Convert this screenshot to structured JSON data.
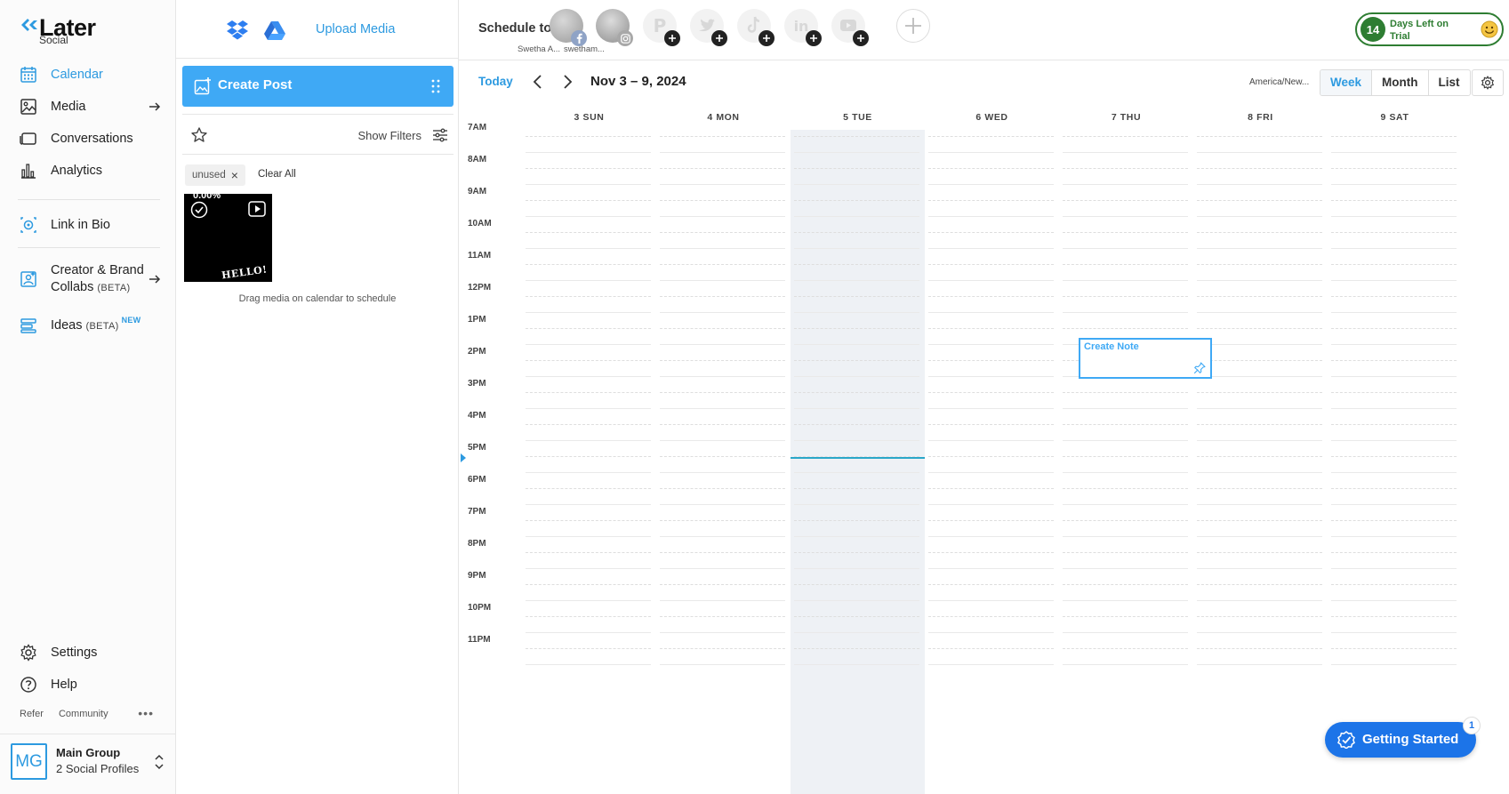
{
  "brand": {
    "name": "Later",
    "product": "Social"
  },
  "colors": {
    "accent": "#2d9ae0",
    "create_post": "#3fa9f5",
    "trial": "#2e7d32",
    "getting_started": "#1c74e8",
    "today_column": "#eef1f5",
    "now_line": "#2aa7c9"
  },
  "sidebar": {
    "items": [
      {
        "label": "Calendar",
        "icon": "calendar-icon",
        "active": true
      },
      {
        "label": "Media",
        "icon": "media-icon",
        "arrow": true
      },
      {
        "label": "Conversations",
        "icon": "conversations-icon"
      },
      {
        "label": "Analytics",
        "icon": "analytics-icon"
      },
      {
        "label": "Link in Bio",
        "icon": "link-in-bio-icon"
      },
      {
        "label_line1": "Creator & Brand",
        "label_line2": "Collabs",
        "beta": "(BETA)",
        "icon": "collabs-icon",
        "arrow": true
      },
      {
        "label": "Ideas",
        "beta": "(BETA)",
        "badge": "NEW",
        "icon": "ideas-icon"
      },
      {
        "label": "Settings",
        "icon": "gear-icon"
      },
      {
        "label": "Help",
        "icon": "help-icon"
      }
    ],
    "footer_links": [
      "Refer",
      "Community"
    ],
    "more_label": "•••",
    "group": {
      "initials": "MG",
      "name": "Main Group",
      "profiles": "2 Social Profiles"
    }
  },
  "media_panel": {
    "upload_label": "Upload Media",
    "create_post_label": "Create Post",
    "show_filters_label": "Show Filters",
    "active_filter": "unused",
    "clear_all_label": "Clear All",
    "thumb_top_text": "0.00%",
    "thumb_caption": "HELLO!",
    "drag_hint": "Drag media on calendar to schedule"
  },
  "header": {
    "schedule_to": "Schedule to",
    "profiles": [
      {
        "name": "Swetha A...",
        "network": "facebook"
      },
      {
        "name": "swetham...",
        "network": "instagram"
      }
    ],
    "add_networks": [
      "pinterest",
      "twitter",
      "tiktok",
      "linkedin",
      "youtube"
    ],
    "trial": {
      "days": "14",
      "text": "Days Left on Trial"
    }
  },
  "calendar": {
    "today_label": "Today",
    "date_range": "Nov 3 – 9, 2024",
    "timezone": "America/New...",
    "views": [
      "Week",
      "Month",
      "List"
    ],
    "active_view": "Week",
    "days": [
      "3 SUN",
      "4 MON",
      "5 TUE",
      "6 WED",
      "7 THU",
      "8 FRI",
      "9 SAT"
    ],
    "today_index": 2,
    "hours": [
      "7AM",
      "8AM",
      "9AM",
      "10AM",
      "11AM",
      "12PM",
      "1PM",
      "2PM",
      "3PM",
      "4PM",
      "5PM",
      "6PM",
      "7PM",
      "8PM",
      "9PM",
      "10PM",
      "11PM"
    ],
    "note": {
      "label": "Create Note",
      "day": "7 THU",
      "hour": "1PM"
    }
  },
  "getting_started": {
    "label": "Getting Started",
    "count": "1"
  }
}
